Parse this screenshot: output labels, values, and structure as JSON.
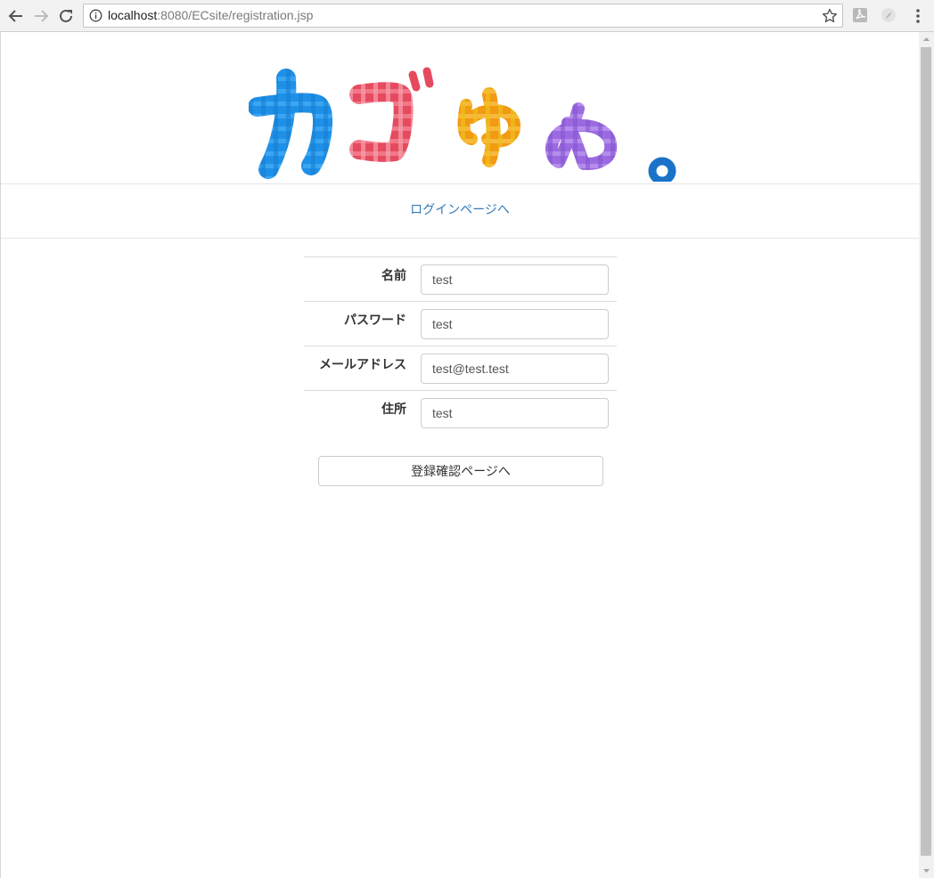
{
  "browser": {
    "url_host": "localhost",
    "url_path": ":8080/ECsite/registration.jsp",
    "icons": {
      "back": "back-arrow-icon",
      "forward": "forward-arrow-icon",
      "reload": "reload-icon",
      "info": "info-icon",
      "bookmark": "star-icon",
      "extension1": "pdf-extension-icon",
      "extension2": "extension-icon",
      "menu": "kebab-menu-icon"
    }
  },
  "header": {
    "logo_text": "カゴゆめ。",
    "logo_colors": [
      "#1e90e8",
      "#e64a5f",
      "#f29a12",
      "#9b6ae0",
      "#1a73c8"
    ]
  },
  "nav": {
    "login_link": "ログインページへ",
    "link_color": "#337ab7"
  },
  "form": {
    "rows": [
      {
        "label": "名前",
        "value": "test"
      },
      {
        "label": "パスワード",
        "value": "test"
      },
      {
        "label": "メールアドレス",
        "value": "test@test.test"
      },
      {
        "label": "住所",
        "value": "test"
      }
    ],
    "submit_label": "登録確認ページへ"
  }
}
